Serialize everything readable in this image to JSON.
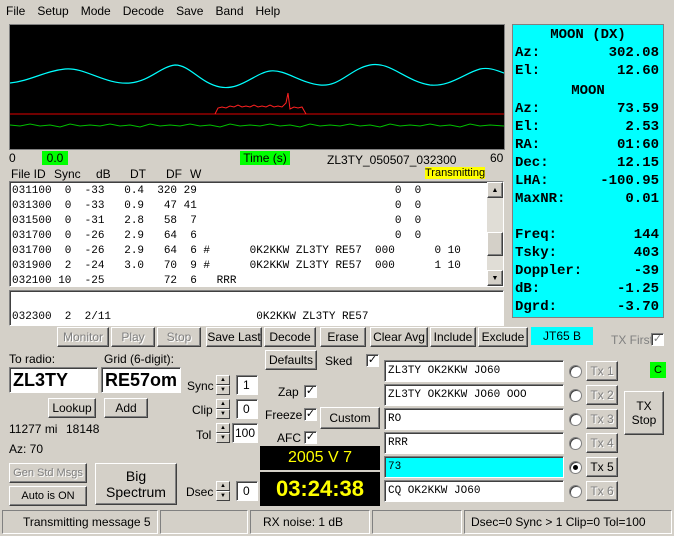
{
  "menu": [
    "File",
    "Setup",
    "Mode",
    "Decode",
    "Save",
    "Band",
    "Help"
  ],
  "plot": {
    "xmin": "0",
    "xmax": "60",
    "left_indicator": "0.0",
    "time_label": "Time (s)",
    "filename": "ZL3TY_050507_032300",
    "status": "Transmitting"
  },
  "decode_header": {
    "file": "File ID",
    "sync": "Sync",
    "db": "dB",
    "dt": "DT",
    "df": "DF",
    "w": "W"
  },
  "decode_lines": [
    "031100  0  -33   0.4  320 29                              0  0",
    "031300  0  -33   0.9   47 41                              0  0",
    "031500  0  -31   2.8   58  7                              0  0",
    "031700  0  -26   2.9   64  6                              0  0",
    "031700  0  -26   2.9   64  6 #      0K2KKW ZL3TY RE57  000      0 10",
    "031900  2  -24   3.0   70  9 #      0K2KKW ZL3TY RE57  000      1 10",
    "032100 10  -25         72  6   RRR"
  ],
  "average_line": "032300  2  2/11                      0K2KKW ZL3TY RE57",
  "buttons": {
    "monitor": "Monitor",
    "play": "Play",
    "stop": "Stop",
    "save_last": "Save Last",
    "decode": "Decode",
    "erase": "Erase",
    "clear_avg": "Clear Avg",
    "include": "Include",
    "exclude": "Exclude",
    "mode": "JT65 B",
    "tx_first": "TX First",
    "lookup": "Lookup",
    "add": "Add",
    "gen_std": "Gen Std Msgs",
    "auto": "Auto is ON",
    "big_spectrum_1": "Big",
    "big_spectrum_2": "Spectrum",
    "defaults": "Defaults",
    "custom": "Custom",
    "tx_stop_1": "TX",
    "tx_stop_2": "Stop"
  },
  "station": {
    "to_radio_label": "To radio:",
    "to_radio": "ZL3TY",
    "grid_label": "Grid (6-digit):",
    "grid": "RE57om",
    "distance_mi": "11277 mi",
    "distance_km": "18148",
    "az": "Az: 70"
  },
  "controls": {
    "sync_label": "Sync",
    "sync": "1",
    "clip_label": "Clip",
    "clip": "0",
    "tol_label": "Tol",
    "tol": "100",
    "dsec_label": "Dsec",
    "dsec": "0",
    "sked": "Sked",
    "zap": "Zap",
    "freeze": "Freeze",
    "afc": "AFC",
    "checked": "✓"
  },
  "clock": {
    "date": "2005 V 7",
    "time": "03:24:38"
  },
  "tx_messages": [
    {
      "text": "ZL3TY OK2KKW JO60",
      "label": "Tx 1",
      "active": false
    },
    {
      "text": "ZL3TY OK2KKW JO60 OOO",
      "label": "Tx 2",
      "active": false
    },
    {
      "text": "RO",
      "label": "Tx 3",
      "active": false
    },
    {
      "text": "RRR",
      "label": "Tx 4",
      "active": false
    },
    {
      "text": "73",
      "label": "Tx 5",
      "active": true
    },
    {
      "text": "CQ OK2KKW JO60",
      "label": "Tx 6",
      "active": false
    }
  ],
  "c_indicator": "C",
  "moon": {
    "dx_title": "MOON (DX)",
    "dx": [
      {
        "k": "Az:",
        "v": "302.08"
      },
      {
        "k": "El:",
        "v": "12.60"
      }
    ],
    "title": "MOON",
    "rows": [
      {
        "k": "Az:",
        "v": "73.59"
      },
      {
        "k": "El:",
        "v": "2.53"
      },
      {
        "k": "RA:",
        "v": "01:60"
      },
      {
        "k": "Dec:",
        "v": "12.15"
      },
      {
        "k": "LHA:",
        "v": "-100.95"
      },
      {
        "k": "MaxNR:",
        "v": "0.01"
      }
    ],
    "rows2": [
      {
        "k": "Freq:",
        "v": "144"
      },
      {
        "k": "Tsky:",
        "v": "403"
      },
      {
        "k": "Doppler:",
        "v": "-39"
      },
      {
        "k": "dB:",
        "v": "-1.25"
      },
      {
        "k": "Dgrd:",
        "v": "-3.70"
      }
    ]
  },
  "statusbar": {
    "msg": "Transmitting message 5",
    "noise": "RX noise:  1 dB",
    "info": "Dsec=0  Sync > 1  Clip=0  Tol=100"
  },
  "colors": {
    "plot_bg": "#000000",
    "cyan": "#00ffff",
    "green_ind": "#00ff00",
    "yellow": "#ffff00"
  }
}
